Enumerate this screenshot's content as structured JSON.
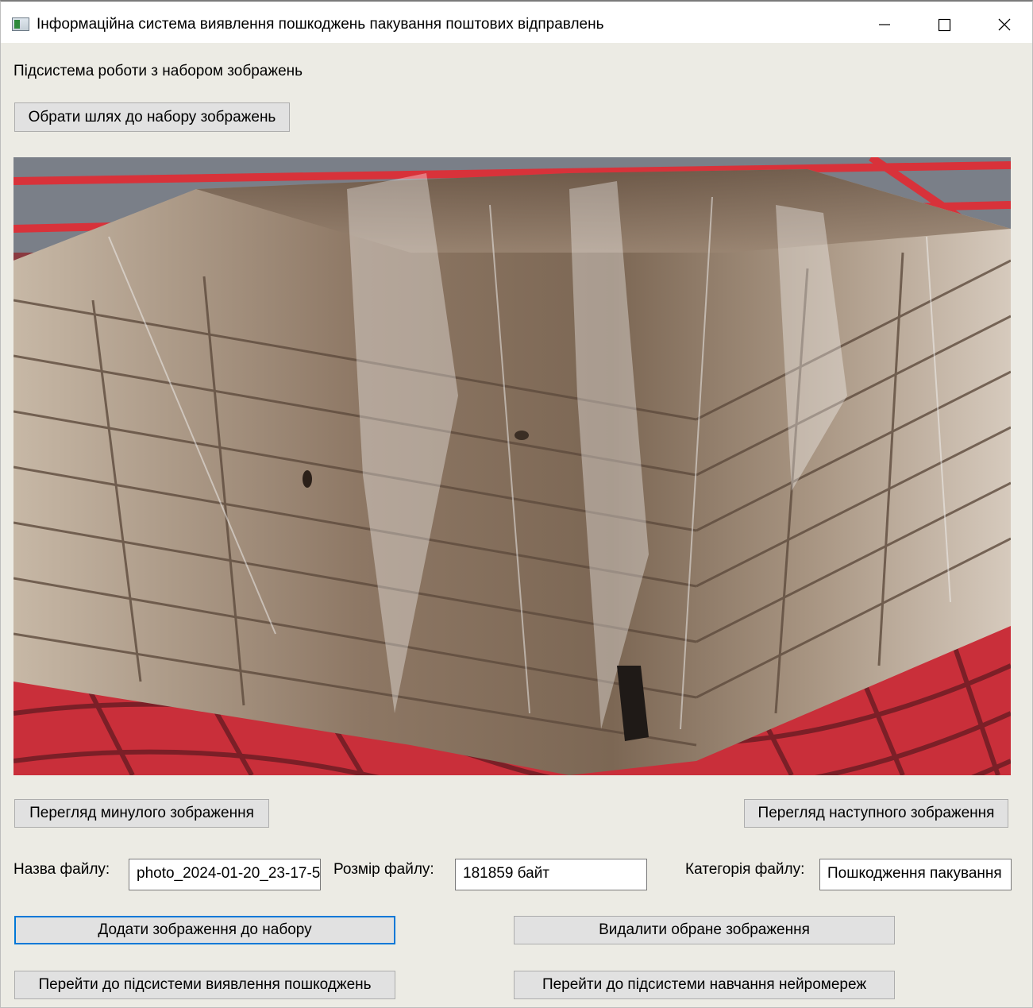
{
  "window": {
    "title": "Інформаційна система виявлення пошкоджень пакування поштових відправлень",
    "controls": {
      "minimize_icon": "minimize-icon",
      "maximize_icon": "maximize-icon",
      "close_icon": "close-icon"
    }
  },
  "main": {
    "subsystem_label": "Підсистема роботи з набором зображень",
    "choose_path_button": "Обрати шлях до набору зображень",
    "prev_image_button": "Перегляд минулого зображення",
    "next_image_button": "Перегляд наступного зображення",
    "file_name_label": "Назва файлу:",
    "file_name_value": "photo_2024-01-20_23-17-5",
    "file_size_label": "Розмір файлу:",
    "file_size_value": "181859 байт",
    "file_category_label": "Категорія файлу:",
    "file_category_value": "Пошкодження пакування",
    "add_image_button": "Додати зображення до набору",
    "delete_image_button": "Видалити обране зображення",
    "go_detection_button": "Перейти до підсистеми виявлення пошкоджень",
    "go_training_button": "Перейти до підсистеми навчання нейромереж"
  },
  "colors": {
    "window_bg": "#ecebe4",
    "button_bg": "#e1e1e1",
    "focus_border": "#0078d7"
  }
}
